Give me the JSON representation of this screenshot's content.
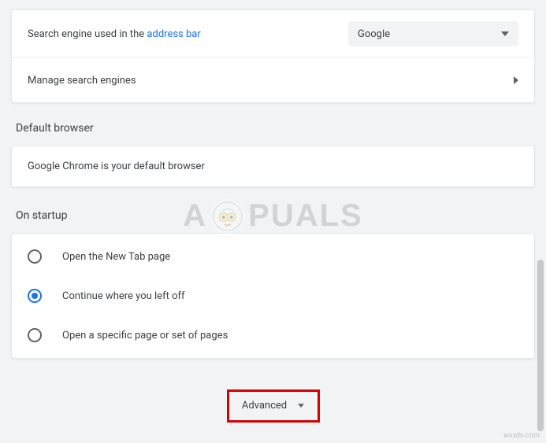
{
  "searchEngine": {
    "labelPrefix": "Search engine used in the ",
    "labelLink": "address bar",
    "selected": "Google",
    "manage": "Manage search engines"
  },
  "defaultBrowser": {
    "title": "Default browser",
    "text": "Google Chrome is your default browser"
  },
  "onStartup": {
    "title": "On startup",
    "options": {
      "newTab": "Open the New Tab page",
      "continue": "Continue where you left off",
      "specific": "Open a specific page or set of pages"
    },
    "selectedIndex": 1
  },
  "advanced": {
    "label": "Advanced"
  },
  "watermark": {
    "left": "A",
    "right": "PUALS"
  },
  "credit": "wsxdn.com"
}
